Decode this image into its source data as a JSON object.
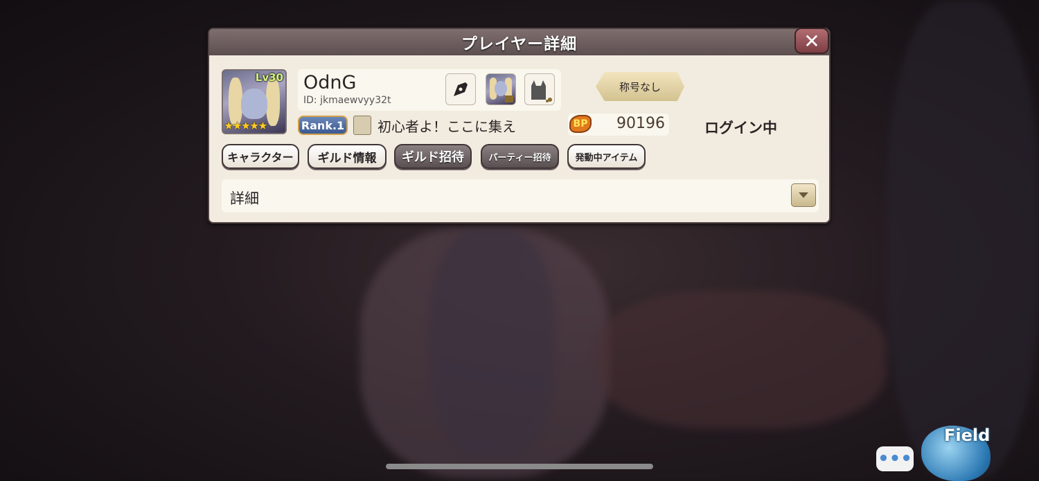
{
  "dialog": {
    "title": "プレイヤー詳細",
    "close_label": "✕"
  },
  "player": {
    "level": "Lv30",
    "stars": "★★★★★",
    "name": "OdnG",
    "id": "ID: jkmaewvyy32t",
    "rank": "Rank.1",
    "guild_name": "初心者よ！ここに集え",
    "bp_label": "BP",
    "bp_value": "90196",
    "title_tag": "称号なし",
    "login_status": "ログイン中"
  },
  "tabs": [
    {
      "label": "キャラクター",
      "style": "light"
    },
    {
      "label": "ギルド情報",
      "style": "light"
    },
    {
      "label": "ギルド招待",
      "style": "dark"
    },
    {
      "label": "パーティー招待",
      "style": "dark"
    },
    {
      "label": "発動中アイテム",
      "style": "light"
    }
  ],
  "detail": {
    "label": "詳細",
    "dropdown_icon": "chevron-down-icon"
  },
  "hud": {
    "chat_label": "•••",
    "field_label": "Field"
  }
}
